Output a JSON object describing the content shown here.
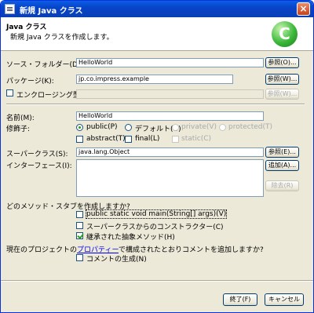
{
  "window": {
    "title": "新規 Java クラス"
  },
  "header": {
    "title": "Java クラス",
    "description": "新規 Java クラスを作成します。",
    "logo_glyph": "C"
  },
  "form": {
    "source_folder": {
      "label": "ソース・フォルダー(D):",
      "value": "HelloWorld",
      "browse": "参照(O)..."
    },
    "package": {
      "label": "パッケージ(K):",
      "value": "jp.co.impress.example",
      "browse": "参照(W)..."
    },
    "enclosing_type": {
      "label": "エンクロージング型(Y):",
      "checked": false,
      "value": "",
      "browse": "参照(W)..."
    },
    "name": {
      "label": "名前(M):",
      "value": "HelloWorld"
    },
    "modifiers": {
      "label": "修飾子:",
      "public": "public(P)",
      "default": "デフォルト(U)",
      "private": "private(V)",
      "protected": "protected(T)",
      "abstract": "abstract(T)",
      "final": "final(L)",
      "static": "static(C)",
      "selected": "public"
    },
    "superclass": {
      "label": "スーパークラス(S):",
      "value": "java.lang.Object",
      "browse": "参照(E)..."
    },
    "interfaces": {
      "label": "インターフェース(I):",
      "add": "追加(A)...",
      "remove": "除去(R)"
    },
    "stubs": {
      "question": "どのメソッド・スタブを作成しますか?",
      "main": "public static void main(String[] args)(V)",
      "constructors": "スーパークラスからのコンストラクター(C)",
      "inherited": "継承された抽象メソッド(H)",
      "main_checked": false,
      "constructors_checked": false,
      "inherited_checked": true
    },
    "comments": {
      "question_prefix": "現在のプロジェクトの",
      "question_link": "プロパティー",
      "question_suffix": "で構成されたとおりコメントを追加しますか?",
      "generate": "コメントの生成(N)",
      "checked": false
    }
  },
  "footer": {
    "finish": "終了(F)",
    "cancel": "キャンセル"
  }
}
